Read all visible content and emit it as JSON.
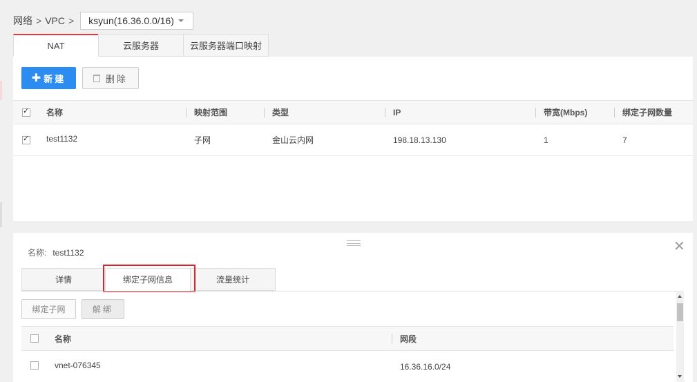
{
  "breadcrumb": {
    "network": "网络",
    "vpc": "VPC",
    "selected_vpc": "ksyun(16.36.0.0/16)"
  },
  "top_tabs": [
    {
      "label": "NAT",
      "active": true
    },
    {
      "label": "云服务器",
      "active": false
    },
    {
      "label": "云服务器端口映射",
      "active": false
    }
  ],
  "toolbar": {
    "new_label": "新建",
    "delete_label": "删除"
  },
  "nat_table": {
    "columns": [
      "名称",
      "映射范围",
      "类型",
      "IP",
      "带宽(Mbps)",
      "绑定子网数量"
    ],
    "rows": [
      {
        "checked": true,
        "name": "test1132",
        "scope": "子网",
        "type": "金山云内网",
        "ip": "198.18.13.130",
        "bandwidth": "1",
        "subnet_count": "7"
      }
    ]
  },
  "detail": {
    "name_label": "名称:",
    "name_value": "test1132",
    "tabs": [
      {
        "label": "详情",
        "active": false
      },
      {
        "label": "绑定子网信息",
        "active": true
      },
      {
        "label": "流量统计",
        "active": false
      }
    ],
    "bind_label": "绑定子网",
    "unbind_label": "解绑",
    "subnet_table": {
      "columns": [
        "名称",
        "网段"
      ],
      "rows": [
        {
          "checked": false,
          "name": "vnet-076345",
          "cidr": "16.36.16.0/24"
        }
      ]
    }
  },
  "colors": {
    "accent": "#2d8cf0",
    "active_tab_border": "#e4393c",
    "highlight_box": "#d9232d"
  }
}
